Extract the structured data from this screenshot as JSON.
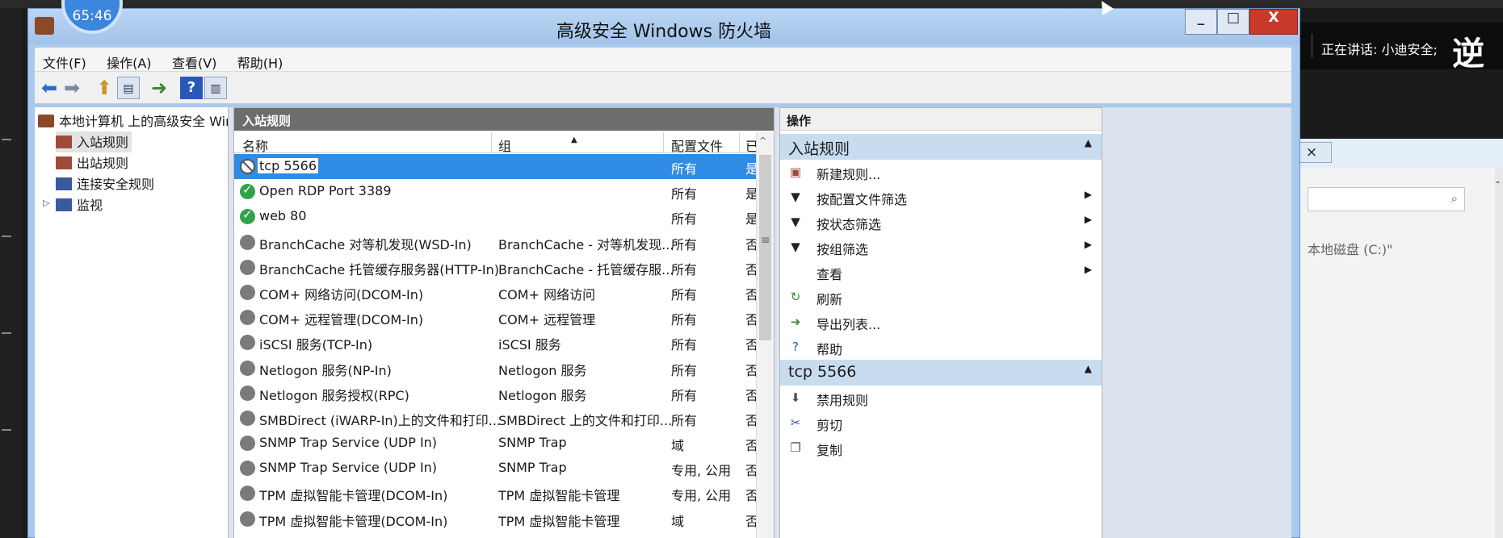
{
  "recording": {
    "timer": "65:46"
  },
  "speaker": {
    "talking_label": "正在讲话: 小迪安全;",
    "big_char": "逆"
  },
  "window": {
    "title": "高级安全 Windows 防火墙",
    "controls": {
      "minimize": "_",
      "maximize": "□",
      "close": "X"
    }
  },
  "menu": [
    "文件(F)",
    "操作(A)",
    "查看(V)",
    "帮助(H)"
  ],
  "toolbar": [
    "back-icon",
    "forward-icon",
    "up-folder-icon",
    "show-hide-tree-icon",
    "export-list-icon",
    "help-icon",
    "show-hide-action-pane-icon"
  ],
  "tree": {
    "root": "本地计算机 上的高级安全 Win",
    "items": [
      "入站规则",
      "出站规则",
      "连接安全规则",
      "监视"
    ],
    "selected": "入站规则"
  },
  "list": {
    "header": "入站规则",
    "columns": [
      "名称",
      "组",
      "配置文件",
      "已"
    ],
    "rows": [
      {
        "status": "blocked",
        "name": "tcp 5566",
        "group": "",
        "profile": "所有",
        "enabled": "是"
      },
      {
        "status": "on",
        "name": "Open RDP Port 3389",
        "group": "",
        "profile": "所有",
        "enabled": "是"
      },
      {
        "status": "on",
        "name": "web 80",
        "group": "",
        "profile": "所有",
        "enabled": "是"
      },
      {
        "status": "off",
        "name": "BranchCache 对等机发现(WSD-In)",
        "group": "BranchCache - 对等机发现...",
        "profile": "所有",
        "enabled": "否"
      },
      {
        "status": "off",
        "name": "BranchCache 托管缓存服务器(HTTP-In)",
        "group": "BranchCache - 托管缓存服...",
        "profile": "所有",
        "enabled": "否"
      },
      {
        "status": "off",
        "name": "COM+ 网络访问(DCOM-In)",
        "group": "COM+ 网络访问",
        "profile": "所有",
        "enabled": "否"
      },
      {
        "status": "off",
        "name": "COM+ 远程管理(DCOM-In)",
        "group": "COM+ 远程管理",
        "profile": "所有",
        "enabled": "否"
      },
      {
        "status": "off",
        "name": "iSCSI 服务(TCP-In)",
        "group": "iSCSI 服务",
        "profile": "所有",
        "enabled": "否"
      },
      {
        "status": "off",
        "name": "Netlogon 服务(NP-In)",
        "group": "Netlogon 服务",
        "profile": "所有",
        "enabled": "否"
      },
      {
        "status": "off",
        "name": "Netlogon 服务授权(RPC)",
        "group": "Netlogon 服务",
        "profile": "所有",
        "enabled": "否"
      },
      {
        "status": "off",
        "name": "SMBDirect (iWARP-In)上的文件和打印...",
        "group": "SMBDirect 上的文件和打印...",
        "profile": "所有",
        "enabled": "否"
      },
      {
        "status": "off",
        "name": "SNMP Trap Service (UDP In)",
        "group": "SNMP Trap",
        "profile": "域",
        "enabled": "否"
      },
      {
        "status": "off",
        "name": "SNMP Trap Service (UDP In)",
        "group": "SNMP Trap",
        "profile": "专用, 公用",
        "enabled": "否"
      },
      {
        "status": "off",
        "name": "TPM 虚拟智能卡管理(DCOM-In)",
        "group": "TPM 虚拟智能卡管理",
        "profile": "专用, 公用",
        "enabled": "否"
      },
      {
        "status": "off",
        "name": "TPM 虚拟智能卡管理(DCOM-In)",
        "group": "TPM 虚拟智能卡管理",
        "profile": "域",
        "enabled": "否"
      }
    ]
  },
  "actions": {
    "title": "操作",
    "section1": {
      "title": "入站规则",
      "items": [
        {
          "icon": "new-rule-icon",
          "label": "新建规则...",
          "submenu": false
        },
        {
          "icon": "filter-icon",
          "label": "按配置文件筛选",
          "submenu": true
        },
        {
          "icon": "filter-icon",
          "label": "按状态筛选",
          "submenu": true
        },
        {
          "icon": "filter-icon",
          "label": "按组筛选",
          "submenu": true
        },
        {
          "icon": "",
          "label": "查看",
          "submenu": true
        },
        {
          "icon": "refresh-icon",
          "label": "刷新",
          "submenu": false
        },
        {
          "icon": "export-list-icon",
          "label": "导出列表...",
          "submenu": false
        },
        {
          "icon": "help-icon",
          "label": "帮助",
          "submenu": false
        }
      ]
    },
    "section2": {
      "title": "tcp 5566",
      "items": [
        {
          "icon": "disable-rule-icon",
          "label": "禁用规则"
        },
        {
          "icon": "cut-icon",
          "label": "剪切"
        },
        {
          "icon": "copy-icon",
          "label": "复制"
        }
      ]
    }
  },
  "background_window": {
    "disk_label": "本地磁盘 (C:)\""
  },
  "colors": {
    "title_bar": "#a9c9ed",
    "selection": "#2f8be3",
    "close_button": "#c83b2a",
    "enabled_check": "#31a24c"
  }
}
